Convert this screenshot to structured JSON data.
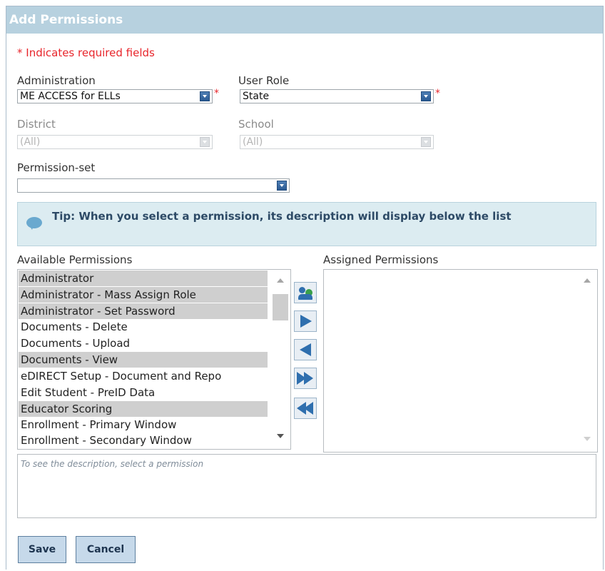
{
  "dialog": {
    "title": "Add Permissions"
  },
  "required_note": "* Indicates required fields",
  "fields": {
    "administration": {
      "label": "Administration",
      "value": "ME ACCESS for ELLs",
      "required_mark": "*"
    },
    "user_role": {
      "label": "User Role",
      "value": "State",
      "required_mark": "*"
    },
    "district": {
      "label": "District",
      "value": "(All)"
    },
    "school": {
      "label": "School",
      "value": "(All)"
    },
    "permission_set": {
      "label": "Permission-set",
      "value": ""
    }
  },
  "tip": {
    "text": "Tip: When you select a permission, its description will display below the list"
  },
  "available": {
    "label": "Available Permissions",
    "items": [
      {
        "label": "Administrator",
        "selected": true
      },
      {
        "label": "Administrator - Mass Assign Role",
        "selected": true
      },
      {
        "label": "Administrator - Set Password",
        "selected": true
      },
      {
        "label": "Documents - Delete",
        "selected": false
      },
      {
        "label": "Documents - Upload",
        "selected": false
      },
      {
        "label": "Documents - View",
        "selected": true
      },
      {
        "label": "eDIRECT Setup - Document and Repo",
        "selected": false
      },
      {
        "label": "Edit Student - PreID Data",
        "selected": false
      },
      {
        "label": "Educator Scoring",
        "selected": true
      },
      {
        "label": "Enrollment - Primary Window",
        "selected": false
      },
      {
        "label": "Enrollment - Secondary Window",
        "selected": false
      }
    ]
  },
  "assigned": {
    "label": "Assigned Permissions",
    "items": []
  },
  "description_placeholder": "To see the description, select a permission",
  "buttons": {
    "save": "Save",
    "cancel": "Cancel"
  },
  "colors": {
    "title_bar": "#b7d1df",
    "required": "#e8252b",
    "accent": "#2f6fae",
    "tip_bg": "#dcecf1"
  }
}
